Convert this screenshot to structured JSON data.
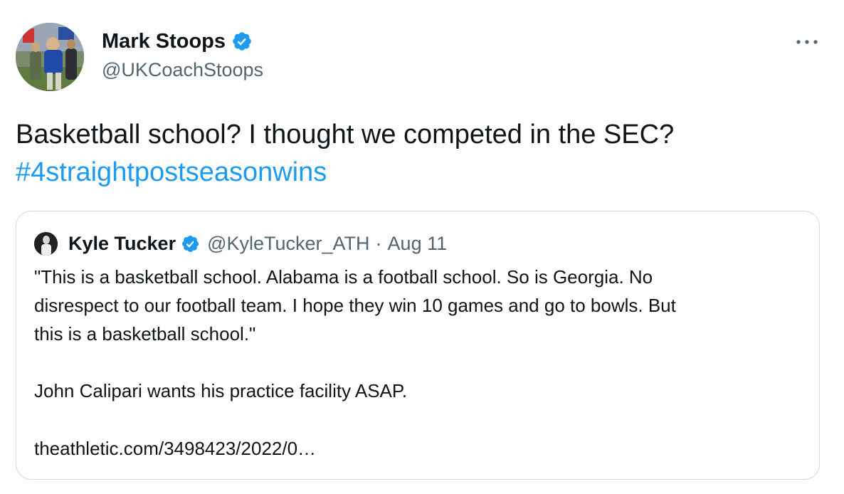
{
  "tweet": {
    "author": {
      "name": "Mark Stoops",
      "handle": "@UKCoachStoops",
      "verified": true
    },
    "more_icon": "more-horizontal-icon",
    "text_line1": "Basketball school?  I thought we competed in the SEC?",
    "hashtag": "#4straightpostseasonwins"
  },
  "quote": {
    "author": {
      "name": "Kyle Tucker",
      "handle": "@KyleTucker_ATH",
      "verified": true
    },
    "separator": "·",
    "date": "Aug 11",
    "body_lines": [
      "\"This is a basketball school. Alabama is a football school. So is Georgia. No",
      "disrespect to our football team. I hope they win 10 games and go to bowls. But",
      "this is a basketball school.\""
    ],
    "paragraph2": "John Calipari wants his practice facility ASAP.",
    "link": "theathletic.com/3498423/2022/0…"
  },
  "colors": {
    "link": "#1d9bf0",
    "verified": "#1d9bf0",
    "secondary_text": "#536471",
    "border": "#cfd9de"
  }
}
